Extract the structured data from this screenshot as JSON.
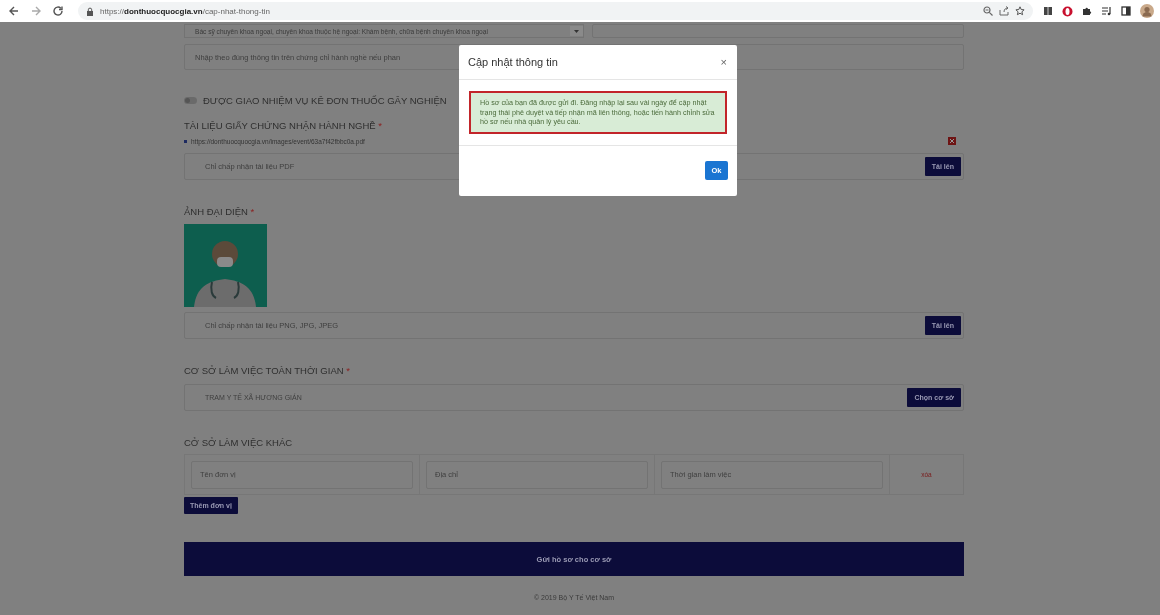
{
  "browser": {
    "scheme": "https://",
    "host": "donthuocquocgia.vn",
    "path": "/cap-nhat-thong-tin"
  },
  "specialty": {
    "value": "Bác sỹ chuyên khoa ngoại, chuyên khoa thuộc hệ ngoại: Khám bệnh, chữa bệnh chuyên khoa ngoại"
  },
  "scope_field": {
    "placeholder": "Nhập theo đúng thông tin trên chứng chỉ hành nghề nếu phan"
  },
  "addictive_toggle": {
    "label": "ĐƯỢC GIAO NHIỆM VỤ KÊ ĐƠN THUỐC GÂY NGHIỆN",
    "on": false
  },
  "certificate": {
    "title": "TÀI LIỆU GIẤY CHỨNG NHẬN HÀNH NGHỀ",
    "required": "*",
    "file": "https://donthuocquocgia.vn/images/event/63a7f42fbbc0a.pdf",
    "placeholder": "Chỉ chấp nhận tài liệu PDF",
    "button": "Tải lên"
  },
  "avatar": {
    "title": "ẢNH ĐẠI DIỆN",
    "required": "*",
    "placeholder": "Chỉ chấp nhận tài liệu PNG, JPG, JPEG",
    "button": "Tải lên"
  },
  "full_time": {
    "title": "CƠ SỞ LÀM VIỆC TOÀN THỜI GIAN",
    "required": "*",
    "value": "TRAM Y TẾ XÃ HƯƠNG GIÁN",
    "button": "Chọn cơ sở"
  },
  "other": {
    "title": "CỞ SỞ LÀM VIỆC KHÁC",
    "fields": [
      {
        "placeholder": "Tên đơn vị"
      },
      {
        "placeholder": "Địa chỉ"
      },
      {
        "placeholder": "Thời gian làm việc"
      }
    ],
    "delete": "xóa",
    "add_button": "Thêm đơn vị"
  },
  "submit_button": "Gửi hồ sơ cho cơ sở",
  "footer": "© 2019 Bộ Y Tế Việt Nam",
  "modal": {
    "title": "Cập nhật thông tin",
    "close": "×",
    "message": "Hồ sơ của bạn đã được gửi đi. Đăng nhập lại sau vài ngày để cập nhật trạng thái phê duyệt và tiếp nhận mã liên thông, hoặc tiến hành chỉnh sửa hồ sơ nếu nhà quản lý yêu cầu.",
    "ok": "Ok"
  }
}
